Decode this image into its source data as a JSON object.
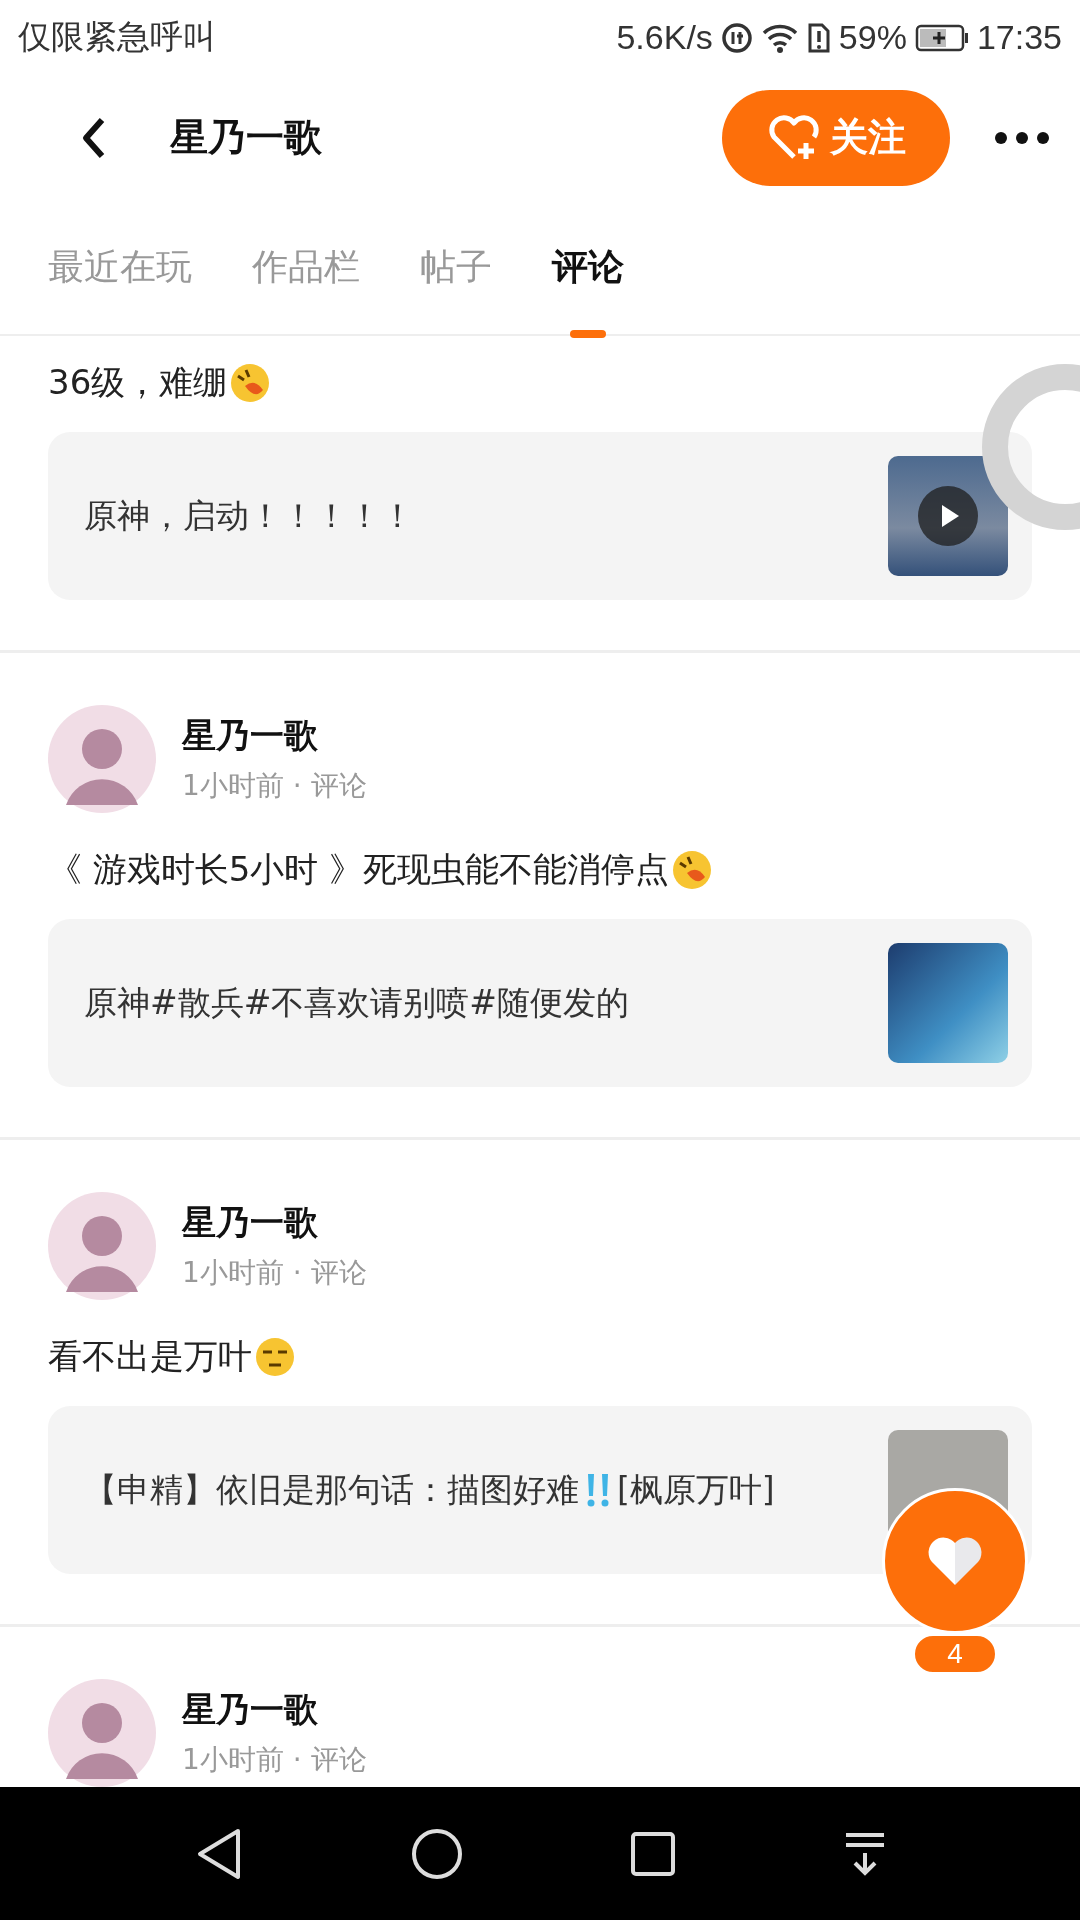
{
  "status_bar": {
    "carrier": "仅限紧急呼叫",
    "speed": "5.6K/s",
    "battery": "59%",
    "time": "17:35"
  },
  "header": {
    "title": "星乃一歌",
    "follow_button": "关注"
  },
  "tabs": [
    {
      "label": "最近在玩",
      "selected": false
    },
    {
      "label": "作品栏",
      "selected": false
    },
    {
      "label": "帖子",
      "selected": false
    },
    {
      "label": "评论",
      "selected": true
    }
  ],
  "posts": [
    {
      "text": "36级，难绷",
      "emoji": {
        "kind": "laugh"
      },
      "card": {
        "text": "原神，启动！！！！！",
        "thumb": {
          "kind": "video"
        }
      }
    },
    {
      "author": "星乃一歌",
      "meta": "1小时前 · 评论",
      "text": "《 游戏时长5小时 》死现虫能不能消停点",
      "emoji": {
        "kind": "laugh"
      },
      "card": {
        "text": "原神#散兵#不喜欢请别喷#随便发的",
        "thumb": {
          "kind": "art"
        }
      }
    },
    {
      "author": "星乃一歌",
      "meta": "1小时前 · 评论",
      "text": "看不出是万叶",
      "emoji": {
        "kind": "unamused"
      },
      "card": {
        "text": "【申精】依旧是那句话：描图好难",
        "emoji": {
          "kind": "exclaim"
        },
        "text_after": "[枫原万叶]",
        "thumb": {
          "kind": "sketch"
        }
      }
    },
    {
      "author": "星乃一歌",
      "meta": "1小时前 · 评论"
    }
  ],
  "like_fab": {
    "count": "4"
  }
}
